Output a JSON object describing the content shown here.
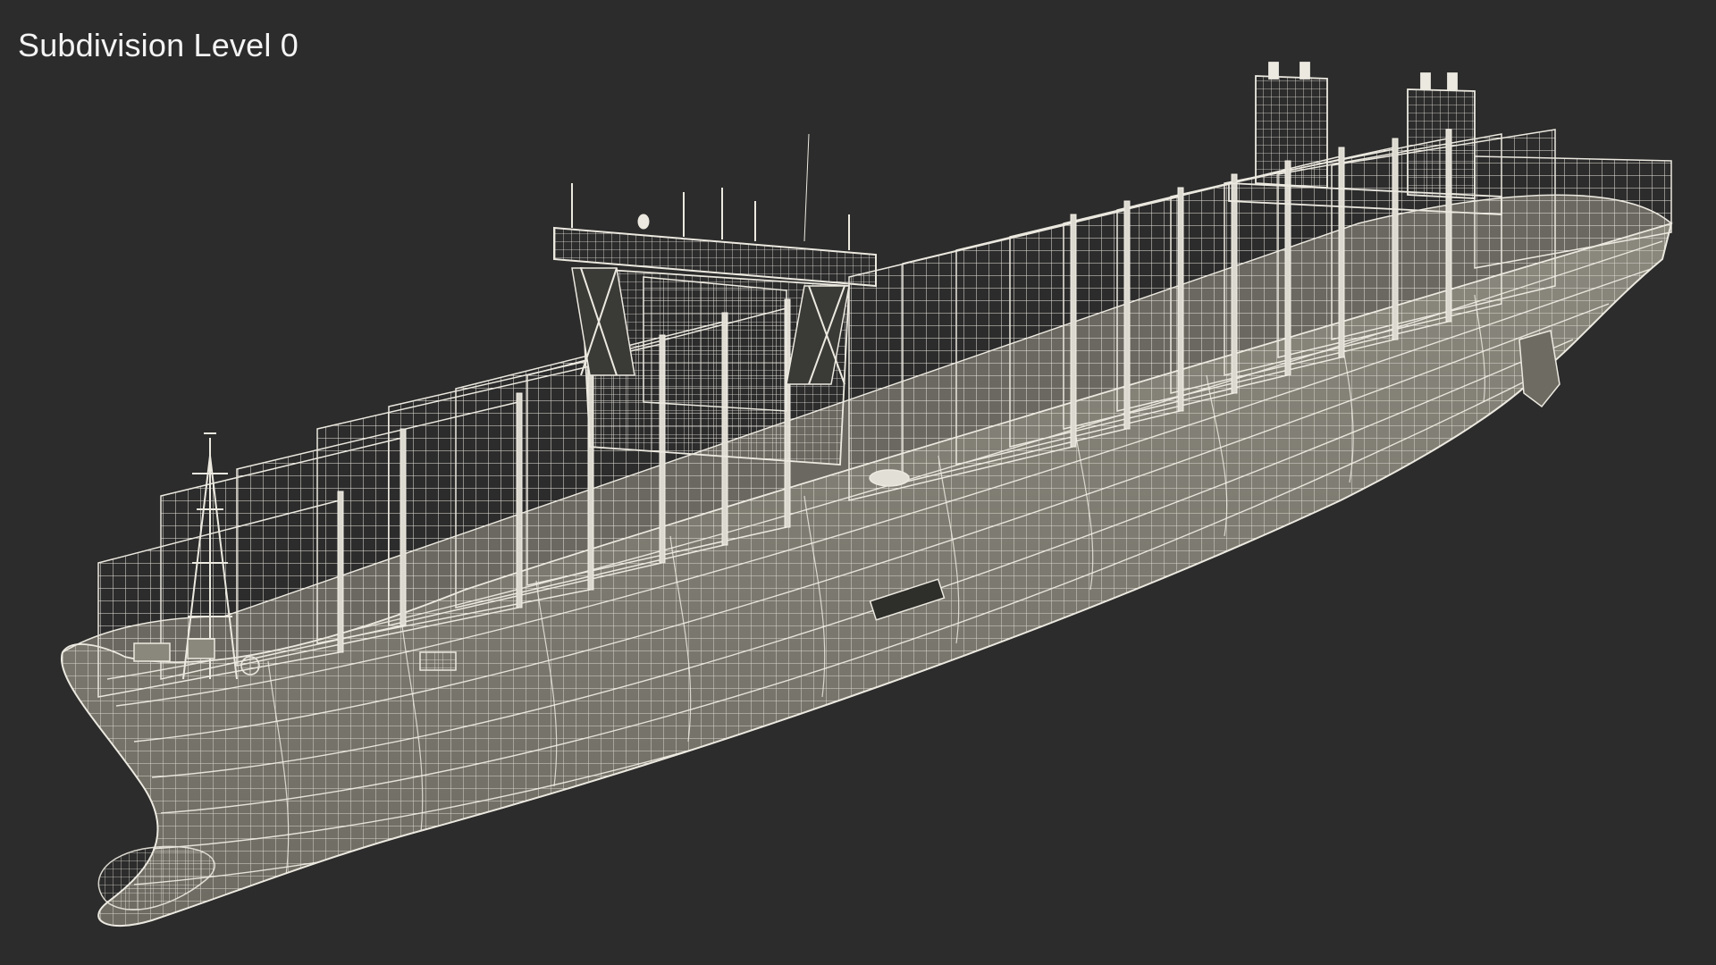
{
  "viewport": {
    "label": "Subdivision Level 0",
    "background": "#2c2c2c"
  },
  "model": {
    "wire_color": "#e8e5dc",
    "surface_color": "#7f7d72",
    "surface_dark": "#5f5e56",
    "deck_color": "#6c6a62"
  }
}
